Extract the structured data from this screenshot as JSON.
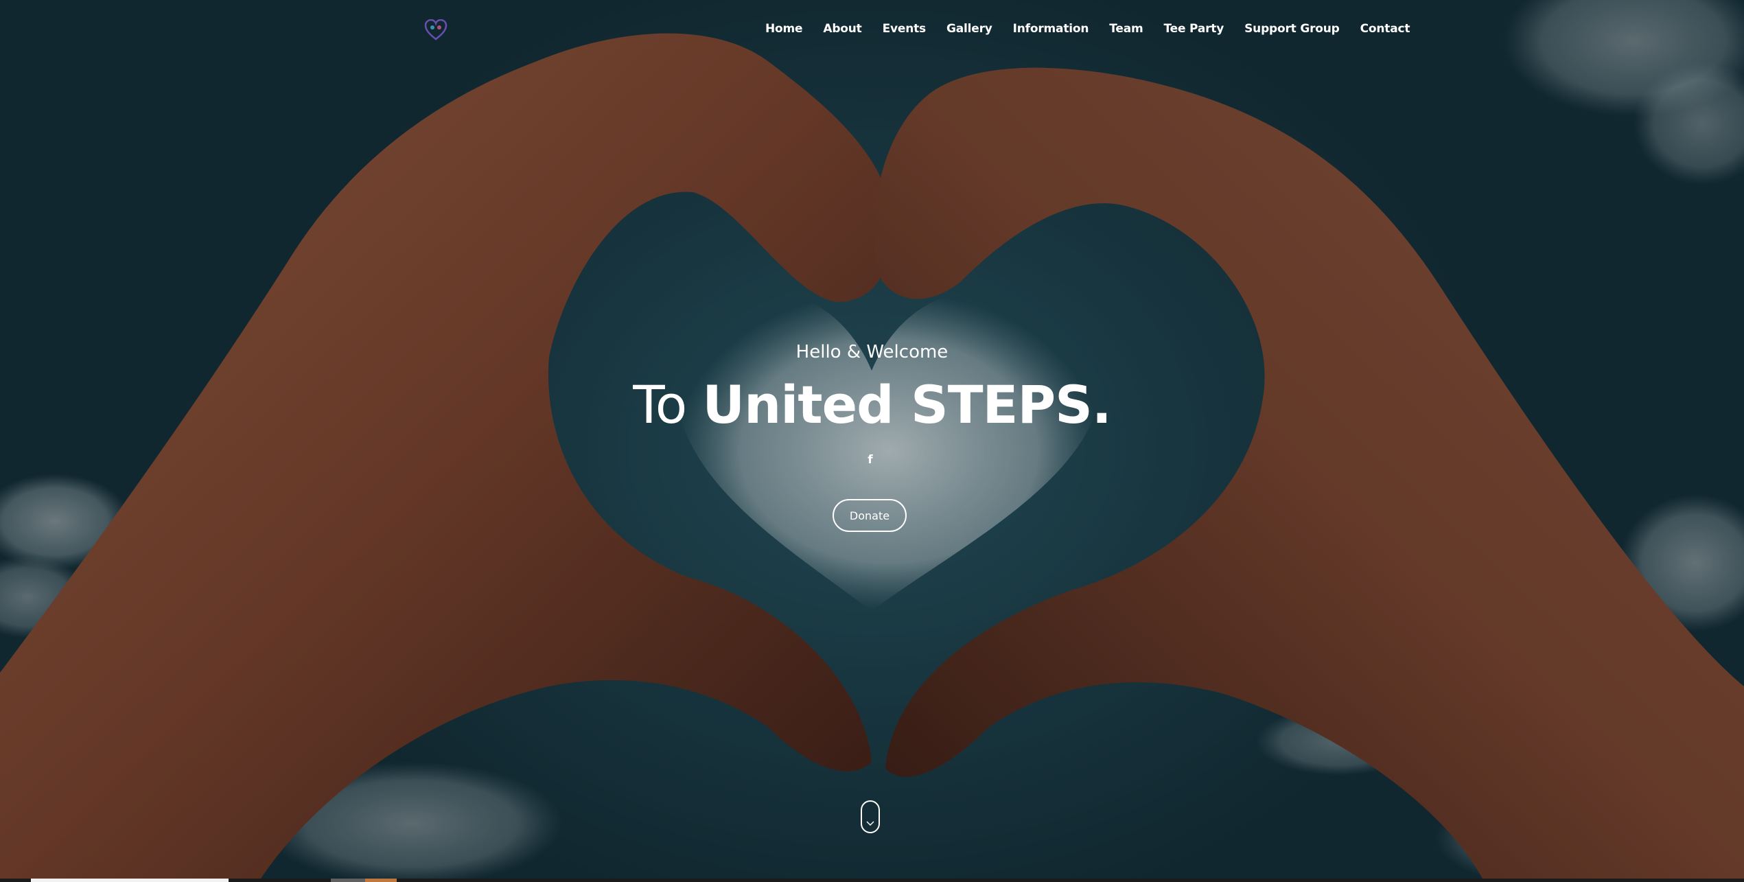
{
  "nav": {
    "items": [
      "Home",
      "About",
      "Events",
      "Gallery",
      "Information",
      "Team",
      "Tee Party",
      "Support Group",
      "Contact"
    ]
  },
  "hero": {
    "greeting": "Hello & Welcome",
    "title_light": "To ",
    "title_bold": "United STEPS.",
    "social_icon": "facebook-icon",
    "donate_label": "Donate",
    "scroll_icon": "chevron-down-icon"
  },
  "colors": {
    "sky": "#1f4450",
    "skin": "#8a5338",
    "accent_orange": "#c0783f",
    "text": "#ffffff"
  }
}
